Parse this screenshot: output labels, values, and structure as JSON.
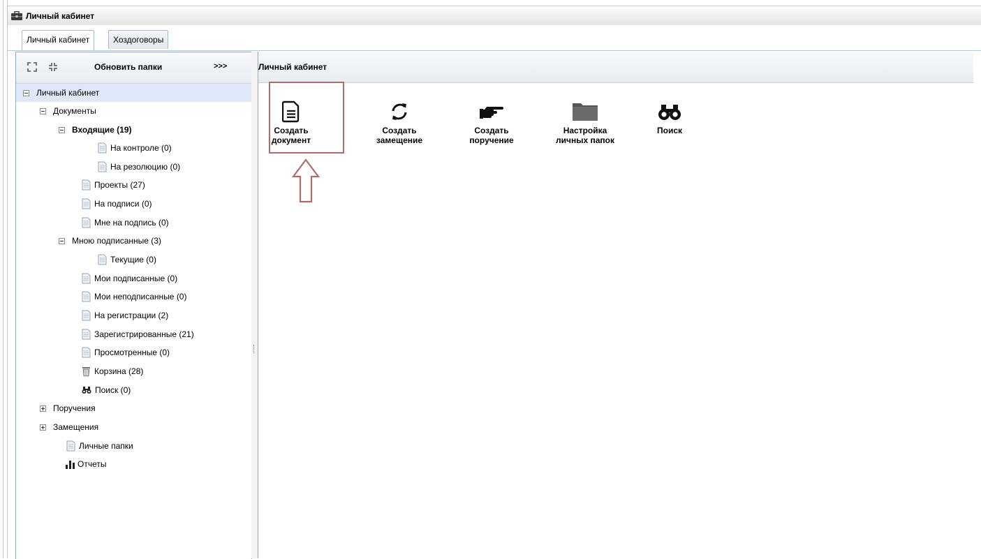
{
  "window": {
    "title": "Личный кабинет"
  },
  "tabs": [
    {
      "label": "Личный кабинет",
      "active": true
    },
    {
      "label": "Хоздоговоры",
      "active": false
    }
  ],
  "sidebar": {
    "refresh_label": "Обновить папки",
    "more_label": ">>>",
    "tree": {
      "root": "Личный кабинет",
      "documents": "Документы",
      "incoming": "Входящие (19)",
      "on_control": "На контроле (0)",
      "on_resolution": "На резолюцию (0)",
      "projects": "Проекты (27)",
      "on_signing": "На подписи (0)",
      "for_my_signature": "Мне на подпись (0)",
      "signed_by_me": "Мною подписанные (3)",
      "current": "Текущие (0)",
      "my_signed": "Мои подписанные (0)",
      "my_unsigned": "Мои неподписанные (0)",
      "on_registration": "На регистрации (2)",
      "registered": "Зарегистрированные (21)",
      "viewed": "Просмотренные (0)",
      "trash": "Корзина (28)",
      "search": "Поиск (0)",
      "assignments": "Поручения",
      "substitutions": "Замещения",
      "personal_folders": "Личные папки",
      "reports": "Отчеты"
    }
  },
  "main": {
    "title": "Личный кабинет",
    "actions": {
      "create_document": [
        "Создать",
        "документ"
      ],
      "create_substitution": [
        "Создать",
        "замещение"
      ],
      "create_assignment": [
        "Создать",
        "поручение"
      ],
      "folder_settings": [
        "Настройка",
        "личных папок"
      ],
      "search": [
        "Поиск"
      ]
    }
  },
  "colors": {
    "highlight": "#b26b6b",
    "selected_row": "#dfe8f6",
    "border": "#99a7b9"
  }
}
